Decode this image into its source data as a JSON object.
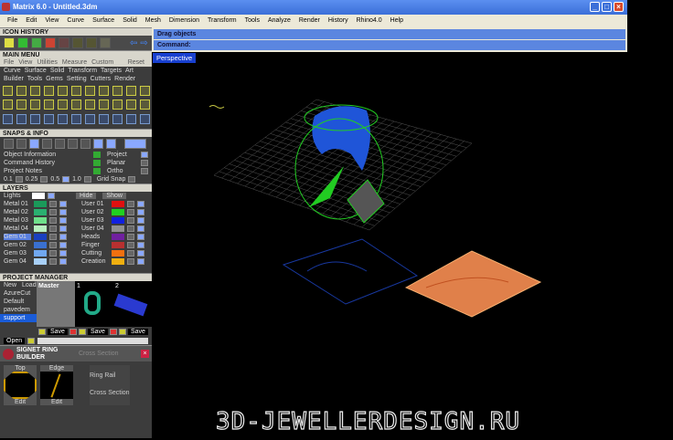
{
  "window": {
    "title": "Matrix 6.0 - Untitled.3dm",
    "controls": [
      "_",
      "□",
      "×"
    ]
  },
  "menu": [
    "File",
    "Edit",
    "View",
    "Curve",
    "Surface",
    "Solid",
    "Mesh",
    "Dimension",
    "Transform",
    "Tools",
    "Analyze",
    "Render",
    "History",
    "Rhino4.0",
    "Help"
  ],
  "icon_history": {
    "title": "ICON HISTORY",
    "back": "⇦",
    "forward": "⇨"
  },
  "main_menu": {
    "title": "MAIN MENU",
    "tabs": [
      "File",
      "View",
      "Utilities",
      "Measure",
      "Custom"
    ],
    "reset": "Reset",
    "categories1": [
      "Curve",
      "Surface",
      "Solid",
      "Transform",
      "Targets",
      "Art"
    ],
    "categories2": [
      "Builder",
      "Tools",
      "Gems",
      "Setting",
      "Cutters",
      "Render"
    ]
  },
  "snaps": {
    "title": "SNAPS & INFO",
    "items": [
      "Object Information",
      "Command History",
      "Project Notes"
    ],
    "options": [
      "Project",
      "Planar",
      "Ortho",
      "Grid Snap"
    ],
    "values": [
      "0.1",
      "0.25",
      "0.5",
      "1.0"
    ]
  },
  "layers": {
    "title": "LAYERS",
    "lights": "Lights",
    "hide": "Hide",
    "show": "Show",
    "left": [
      {
        "name": "Metal 01",
        "color": "#1a9a5a"
      },
      {
        "name": "Metal 02",
        "color": "#2ab070"
      },
      {
        "name": "Metal 03",
        "color": "#6ee08a"
      },
      {
        "name": "Metal 04",
        "color": "#b8f0c0"
      },
      {
        "name": "Gem 01",
        "color": "#1a40c0"
      },
      {
        "name": "Gem 02",
        "color": "#3a70d0"
      },
      {
        "name": "Gem 03",
        "color": "#70a8f0"
      },
      {
        "name": "Gem 04",
        "color": "#a8d0f8"
      }
    ],
    "right": [
      {
        "name": "User 01",
        "color": "#e01010"
      },
      {
        "name": "User 02",
        "color": "#20d020"
      },
      {
        "name": "User 03",
        "color": "#1020e0"
      },
      {
        "name": "User 04",
        "color": "#909090"
      },
      {
        "name": "Heads",
        "color": "#7020a0"
      },
      {
        "name": "Finger",
        "color": "#b83030"
      },
      {
        "name": "Cutting",
        "color": "#f07010"
      },
      {
        "name": "Creation",
        "color": "#f0b010"
      }
    ]
  },
  "project_manager": {
    "title": "PROJECT MANAGER",
    "new": "New",
    "load": "Load",
    "projects": [
      "AzureCut",
      "Default",
      "pavedem",
      "support"
    ],
    "open": "Open",
    "thumb_label": "Master",
    "thumb_nums": [
      "1",
      "2"
    ],
    "save": "Save"
  },
  "signet": {
    "title": "SIGNET RING BUILDER",
    "tab": "Cross Section",
    "panels": [
      "Top",
      "Edge"
    ],
    "edit": "Edit",
    "options": [
      "Ring Rail",
      "Cross Section"
    ]
  },
  "command": {
    "prompt": "Drag objects",
    "label": "Command:"
  },
  "viewport": {
    "label": "Perspective"
  },
  "watermark": "3D-JEWELLERDESIGN.RU"
}
